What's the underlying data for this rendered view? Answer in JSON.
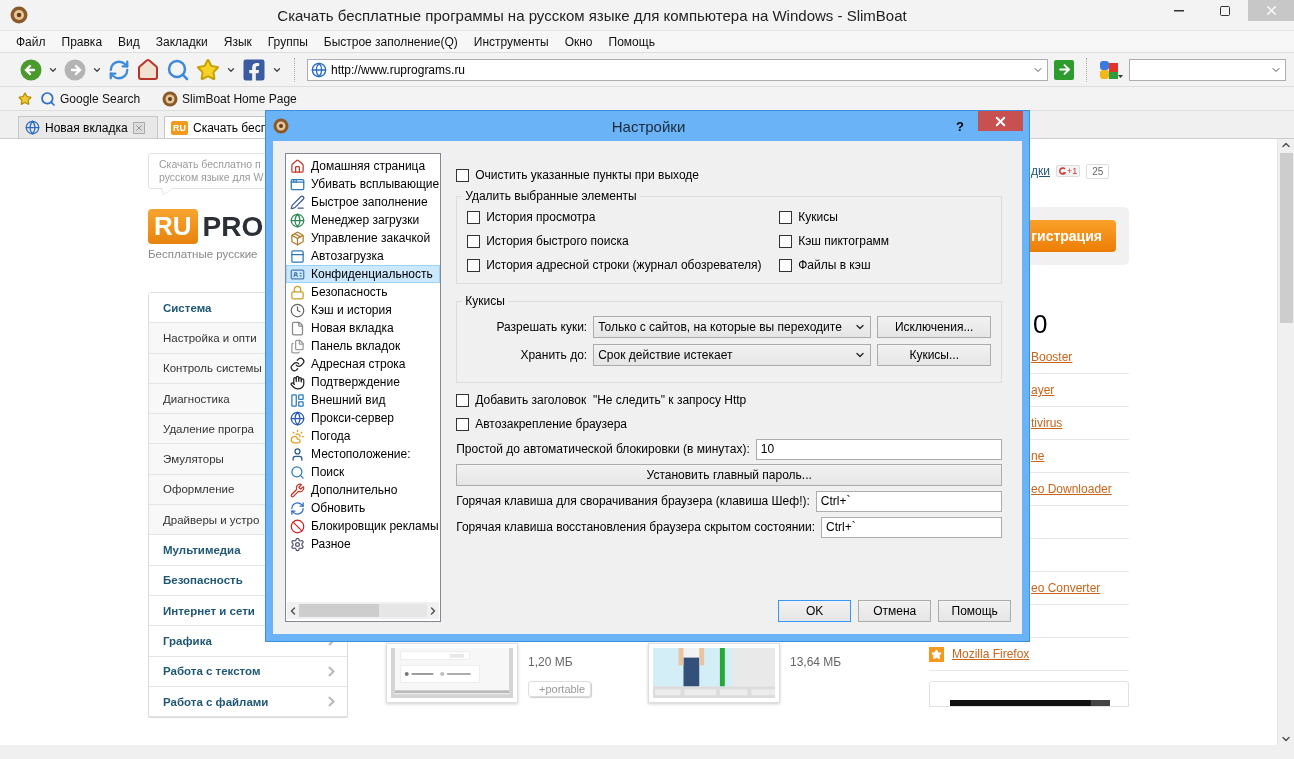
{
  "window": {
    "title": "Скачать бесплатные программы на русском языке для компьютера на Windows - SlimBoat"
  },
  "menu": [
    "Файл",
    "Правка",
    "Вид",
    "Закладки",
    "Язык",
    "Группы",
    "Быстрое заполнение(Q)",
    "Инструменты",
    "Окно",
    "Помощь"
  ],
  "address_bar": {
    "value": "http://www.ruprograms.ru"
  },
  "bookmarks": [
    {
      "label": "Google Search"
    },
    {
      "label": "SlimBoat Home Page"
    }
  ],
  "tabs": [
    {
      "label": "Новая вкладка",
      "selected": false
    },
    {
      "label": "Скачать бесп",
      "badge": "RU",
      "selected": true
    }
  ],
  "page": {
    "bubble_lines": [
      "Скачать бесплатно п",
      "русском языке для W"
    ],
    "logo": {
      "badge": "RU",
      "text": "PRO"
    },
    "tagline": "Бесплатные русские",
    "categories": [
      {
        "label": "Система",
        "kind": "section",
        "arrow": false
      },
      {
        "label": "Настройка и опти",
        "kind": "item",
        "arrow": false
      },
      {
        "label": "Контроль системы",
        "kind": "item",
        "arrow": false
      },
      {
        "label": "Диагностика",
        "kind": "item",
        "arrow": false
      },
      {
        "label": "Удаление програ",
        "kind": "item",
        "arrow": false
      },
      {
        "label": "Эмуляторы",
        "kind": "item",
        "arrow": false
      },
      {
        "label": "Оформление",
        "kind": "item",
        "arrow": false
      },
      {
        "label": "Драйверы и устро",
        "kind": "item",
        "arrow": false
      },
      {
        "label": "Мультимедиа",
        "kind": "section",
        "arrow": false
      },
      {
        "label": "Безопасность",
        "kind": "section",
        "arrow": false
      },
      {
        "label": "Интернет и сети",
        "kind": "section",
        "arrow": false
      },
      {
        "label": "Графика",
        "kind": "section",
        "arrow": true
      },
      {
        "label": "Работа с текстом",
        "kind": "section",
        "arrow": true
      },
      {
        "label": "Работа с файлами",
        "kind": "section",
        "arrow": true
      }
    ],
    "share": {
      "link": "дки",
      "plus": "+1",
      "count": "25"
    },
    "register_button": "гистрация",
    "heading": "0",
    "links": [
      {
        "kind": "link",
        "label": "Booster"
      },
      {
        "kind": "link",
        "label": "ayer"
      },
      {
        "kind": "link",
        "label": "tivirus"
      },
      {
        "kind": "link",
        "label": "ne"
      },
      {
        "kind": "link",
        "label": "eo Downloader"
      },
      {
        "kind": "blank"
      },
      {
        "kind": "blank"
      },
      {
        "kind": "link",
        "label": "eo Converter"
      },
      {
        "kind": "blank"
      },
      {
        "kind": "star_link",
        "label": "Mozilla Firefox"
      }
    ],
    "downloads": [
      {
        "size": "1,20 МБ",
        "tag": "+portable"
      },
      {
        "size": "13,64 МБ"
      }
    ]
  },
  "dialog": {
    "title": "Настройки",
    "help": "?",
    "nav": [
      {
        "label": "Домашняя страница",
        "selected": false
      },
      {
        "label": "Убивать всплывающие",
        "selected": false
      },
      {
        "label": "Быстрое заполнение",
        "selected": false
      },
      {
        "label": "Менеджер загрузки",
        "selected": false
      },
      {
        "label": "Управление закачкой",
        "selected": false
      },
      {
        "label": "Автозагрузка",
        "selected": false
      },
      {
        "label": "Конфиденциальность",
        "selected": true
      },
      {
        "label": "Безопасность",
        "selected": false
      },
      {
        "label": "Кэш и история",
        "selected": false
      },
      {
        "label": "Новая вкладка",
        "selected": false
      },
      {
        "label": "Панель вкладок",
        "selected": false
      },
      {
        "label": "Адресная строка",
        "selected": false
      },
      {
        "label": "Подтверждение",
        "selected": false
      },
      {
        "label": "Внешний вид",
        "selected": false
      },
      {
        "label": "Прокси-сервер",
        "selected": false
      },
      {
        "label": "Погода",
        "selected": false
      },
      {
        "label": "Местоположение:",
        "selected": false
      },
      {
        "label": "Поиск",
        "selected": false
      },
      {
        "label": "Дополнительно",
        "selected": false
      },
      {
        "label": "Обновить",
        "selected": false
      },
      {
        "label": "Блокировщик рекламы",
        "selected": false
      },
      {
        "label": "Разное",
        "selected": false
      }
    ],
    "clear_on_exit": {
      "label": "Очистить указанные пункты при выходе",
      "checked": false
    },
    "delete_group": {
      "title": "Удалить выбранные элементы",
      "items": [
        {
          "label": "История просмотра",
          "checked": false
        },
        {
          "label": "Кукисы",
          "checked": false
        },
        {
          "label": "История быстрого поиска",
          "checked": false
        },
        {
          "label": "Кэш пиктограмм",
          "checked": false
        },
        {
          "label": "История адресной строки (журнал обозревателя)",
          "checked": false
        },
        {
          "label": "Файлы в кэш",
          "checked": false
        }
      ]
    },
    "cookies_group": {
      "title": "Кукисы",
      "rows": [
        {
          "label": "Разрешать куки:",
          "value": "Только с сайтов, на которые вы переходите",
          "button": "Исключения..."
        },
        {
          "label": "Хранить до:",
          "value": "Срок действие истекает",
          "button": "Кукисы..."
        }
      ]
    },
    "options": [
      {
        "label": "Добавить заголовок  \"Не следить\" к запросу Http",
        "checked": false
      },
      {
        "label": "Автозакрепление браузера",
        "checked": false
      }
    ],
    "lock_timeout": {
      "label": "Простой до автоматической блокировки (в минутах):",
      "value": "10"
    },
    "master_password_button": "Установить главный пароль...",
    "hotkeys": [
      {
        "label": "Горячая клавиша для сворачивания браузера (клавиша Шеф!):",
        "value": "Ctrl+`"
      },
      {
        "label": "Горячая клавиша восстановления браузера скрытом состоянии:",
        "value": "Ctrl+`"
      }
    ],
    "buttons": [
      {
        "label": "OK",
        "default": true
      },
      {
        "label": "Отмена",
        "default": false
      },
      {
        "label": "Помощь",
        "default": false
      }
    ]
  }
}
